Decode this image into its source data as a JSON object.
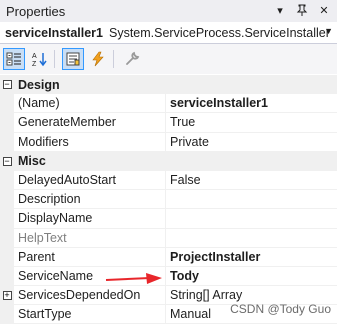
{
  "window": {
    "title": "Properties"
  },
  "object_selector": {
    "name": "serviceInstaller1",
    "type": "System.ServiceProcess.ServiceInstaller"
  },
  "categories": [
    {
      "label": "Design",
      "props": [
        {
          "name": "(Name)",
          "value": "serviceInstaller1",
          "bold": true
        },
        {
          "name": "GenerateMember",
          "value": "True"
        },
        {
          "name": "Modifiers",
          "value": "Private"
        }
      ]
    },
    {
      "label": "Misc",
      "props": [
        {
          "name": "DelayedAutoStart",
          "value": "False"
        },
        {
          "name": "Description",
          "value": ""
        },
        {
          "name": "DisplayName",
          "value": ""
        },
        {
          "name": "HelpText",
          "value": "",
          "disabled": true
        },
        {
          "name": "Parent",
          "value": "ProjectInstaller",
          "bold": true
        },
        {
          "name": "ServiceName",
          "value": "Tody",
          "bold": true
        },
        {
          "name": "ServicesDependedOn",
          "value": "String[] Array",
          "expandable": true
        },
        {
          "name": "StartType",
          "value": "Manual"
        }
      ]
    }
  ],
  "watermark": "CSDN @Tody Guo",
  "colors": {
    "arrow": "#e8262b",
    "toolbar_active": "#c9def5"
  }
}
